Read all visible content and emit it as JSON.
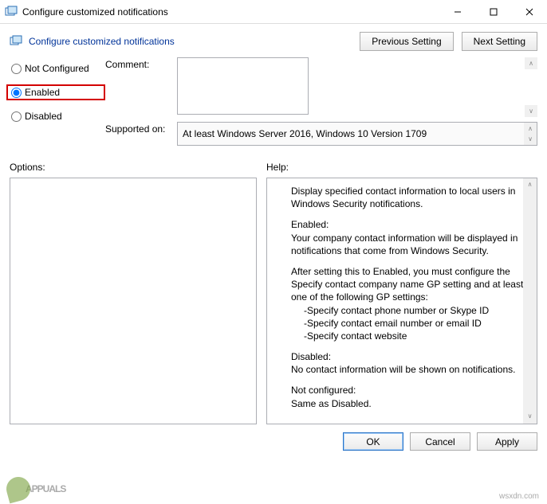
{
  "window": {
    "title": "Configure customized notifications"
  },
  "header": {
    "title": "Configure customized notifications",
    "prev": "Previous Setting",
    "next": "Next Setting"
  },
  "state": {
    "not_configured": "Not Configured",
    "enabled": "Enabled",
    "disabled": "Disabled"
  },
  "comment": {
    "label": "Comment:",
    "value": ""
  },
  "supported": {
    "label": "Supported on:",
    "value": "At least Windows Server 2016, Windows 10 Version 1709"
  },
  "panels": {
    "options_label": "Options:",
    "help_label": "Help:"
  },
  "help": {
    "p1": "Display specified contact information to local users in Windows Security notifications.",
    "p2_title": "Enabled:",
    "p2": "Your company contact information will be displayed in notifications that come from Windows Security.",
    "p3": "After setting this to Enabled, you must configure the Specify contact company name GP setting and at least one of the following GP settings:",
    "p3_a": "-Specify contact phone number or Skype ID",
    "p3_b": "-Specify contact email number or email ID",
    "p3_c": "-Specify contact website",
    "p4_title": "Disabled:",
    "p4": "No contact information will be shown on notifications.",
    "p5_title": "Not configured:",
    "p5": "Same as Disabled."
  },
  "buttons": {
    "ok": "OK",
    "cancel": "Cancel",
    "apply": "Apply"
  },
  "watermark": {
    "brand": "PPUALS",
    "source": "wsxdn.com"
  }
}
